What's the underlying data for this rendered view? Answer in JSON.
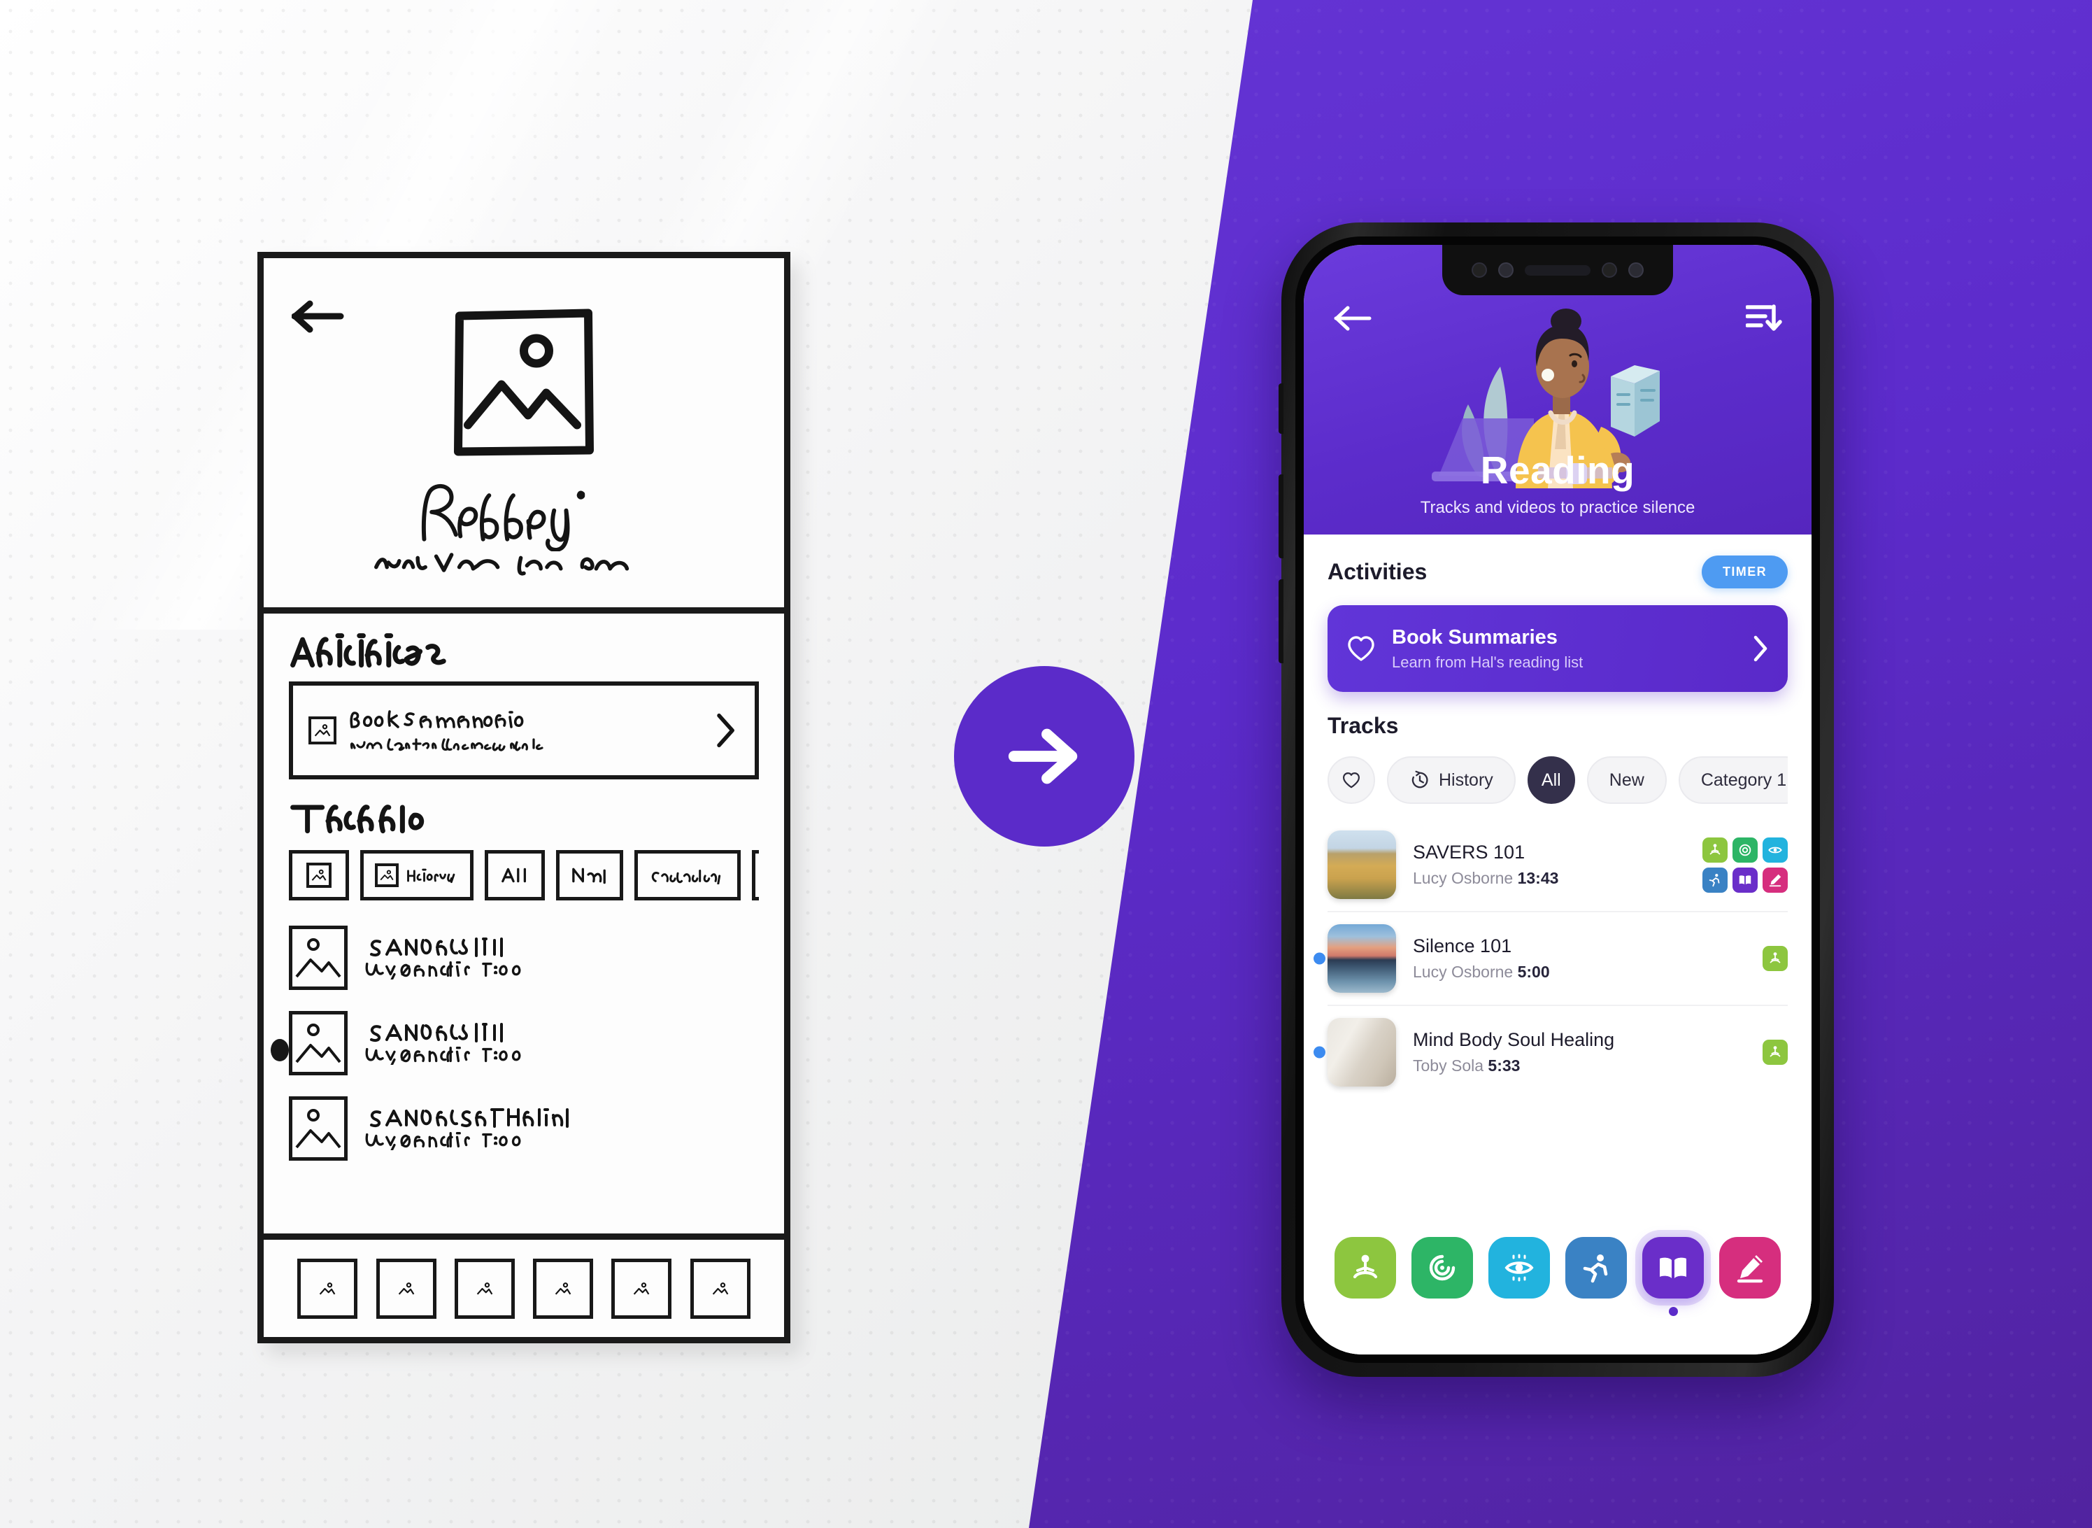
{
  "colors": {
    "brand_purple": "#5B2BC9",
    "header_purple": "#6B3BDC",
    "timer_blue": "#4E9BF2",
    "chip_active": "#34304B",
    "dot_blue": "#3C8BF0",
    "nav_silence": "#8DC63F",
    "nav_affirmation": "#2DB566",
    "nav_visualization": "#22B3DE",
    "nav_exercise": "#3A82C4",
    "nav_reading": "#6A2EC9",
    "nav_scribing": "#D62E7E"
  },
  "arrow_badge": {
    "icon": "arrow-right-icon"
  },
  "wireframe": {
    "back_icon": "back-arrow-icon",
    "image_placeholder_icon": "image-placeholder-icon",
    "title_sketch": "Reading",
    "subtitle_sketch": "Tracks Videos practice silence",
    "activities_heading": "Activities",
    "activity_card": {
      "icon": "image-placeholder-icon",
      "title": "Book Summaries",
      "subtitle": "Learn from Hal's reading list",
      "chevron_icon": "chevron-right-icon"
    },
    "tracks_heading": "Fresh",
    "chips": [
      {
        "label": "",
        "icon": "image-placeholder-icon"
      },
      {
        "label": "History",
        "icon": "image-placeholder-icon"
      },
      {
        "label": "All",
        "icon": ""
      },
      {
        "label": "New",
        "icon": ""
      },
      {
        "label": "Category 1",
        "icon": ""
      }
    ],
    "tracks": [
      {
        "title": "SAVERS 101",
        "artist": "Lucy Osborne",
        "duration": "14:00",
        "dot": false
      },
      {
        "title": "SAVERS 101",
        "artist": "Lucy Osborne",
        "duration": "14:00",
        "dot": true
      },
      {
        "title": "SAVERS Silence Healing",
        "artist": "Lucy Osborne",
        "duration": "14:00",
        "dot": false
      }
    ],
    "bottom_nav_count": 6
  },
  "phone": {
    "header": {
      "back_icon": "back-arrow-icon",
      "sort_icon": "sort-descending-icon",
      "illustration": "woman-reading-book-illustration",
      "title": "Reading",
      "subtitle": "Tracks and videos to practice silence"
    },
    "activities": {
      "heading": "Activities",
      "timer_label": "TIMER",
      "card": {
        "icon": "heart-outline-icon",
        "title": "Book Summaries",
        "subtitle": "Learn from Hal's reading list",
        "chevron_icon": "chevron-right-icon"
      }
    },
    "tracks": {
      "heading": "Tracks",
      "chips": [
        {
          "label": "",
          "icon": "heart-outline-icon",
          "active": false,
          "icon_only": true
        },
        {
          "label": "History",
          "icon": "history-clock-icon",
          "active": false,
          "icon_only": false
        },
        {
          "label": "All",
          "icon": "",
          "active": true,
          "icon_only": false
        },
        {
          "label": "New",
          "icon": "",
          "active": false,
          "icon_only": false
        },
        {
          "label": "Category 1",
          "icon": "",
          "active": false,
          "icon_only": false
        },
        {
          "label": "",
          "icon": "",
          "active": false,
          "icon_only": false
        }
      ],
      "items": [
        {
          "title": "SAVERS 101",
          "artist": "Lucy Osborne",
          "duration": "13:43",
          "thumb": "golden-field-landscape",
          "dot": false,
          "badges": [
            "silence",
            "affirmation",
            "visualization",
            "exercise",
            "reading",
            "scribing"
          ]
        },
        {
          "title": "Silence 101",
          "artist": "Lucy Osborne",
          "duration": "5:00",
          "thumb": "sunset-water-reflection",
          "dot": true,
          "badges": [
            "silence"
          ]
        },
        {
          "title": "Mind Body Soul Healing",
          "artist": "Toby Sola",
          "duration": "5:33",
          "thumb": "bright-interior-stretch",
          "dot": true,
          "badges": [
            "silence"
          ]
        }
      ]
    },
    "bottom_nav": [
      {
        "name": "silence",
        "icon": "meditating-person-icon",
        "color": "#8DC63F",
        "active": false
      },
      {
        "name": "affirmation",
        "icon": "target-spiral-icon",
        "color": "#2DB566",
        "active": false
      },
      {
        "name": "visualization",
        "icon": "eye-radiating-icon",
        "color": "#22B3DE",
        "active": false
      },
      {
        "name": "exercise",
        "icon": "running-person-icon",
        "color": "#3A82C4",
        "active": false
      },
      {
        "name": "reading",
        "icon": "open-book-icon",
        "color": "#6A2EC9",
        "active": true
      },
      {
        "name": "scribing",
        "icon": "writing-hand-icon",
        "color": "#D62E7E",
        "active": false
      }
    ]
  }
}
